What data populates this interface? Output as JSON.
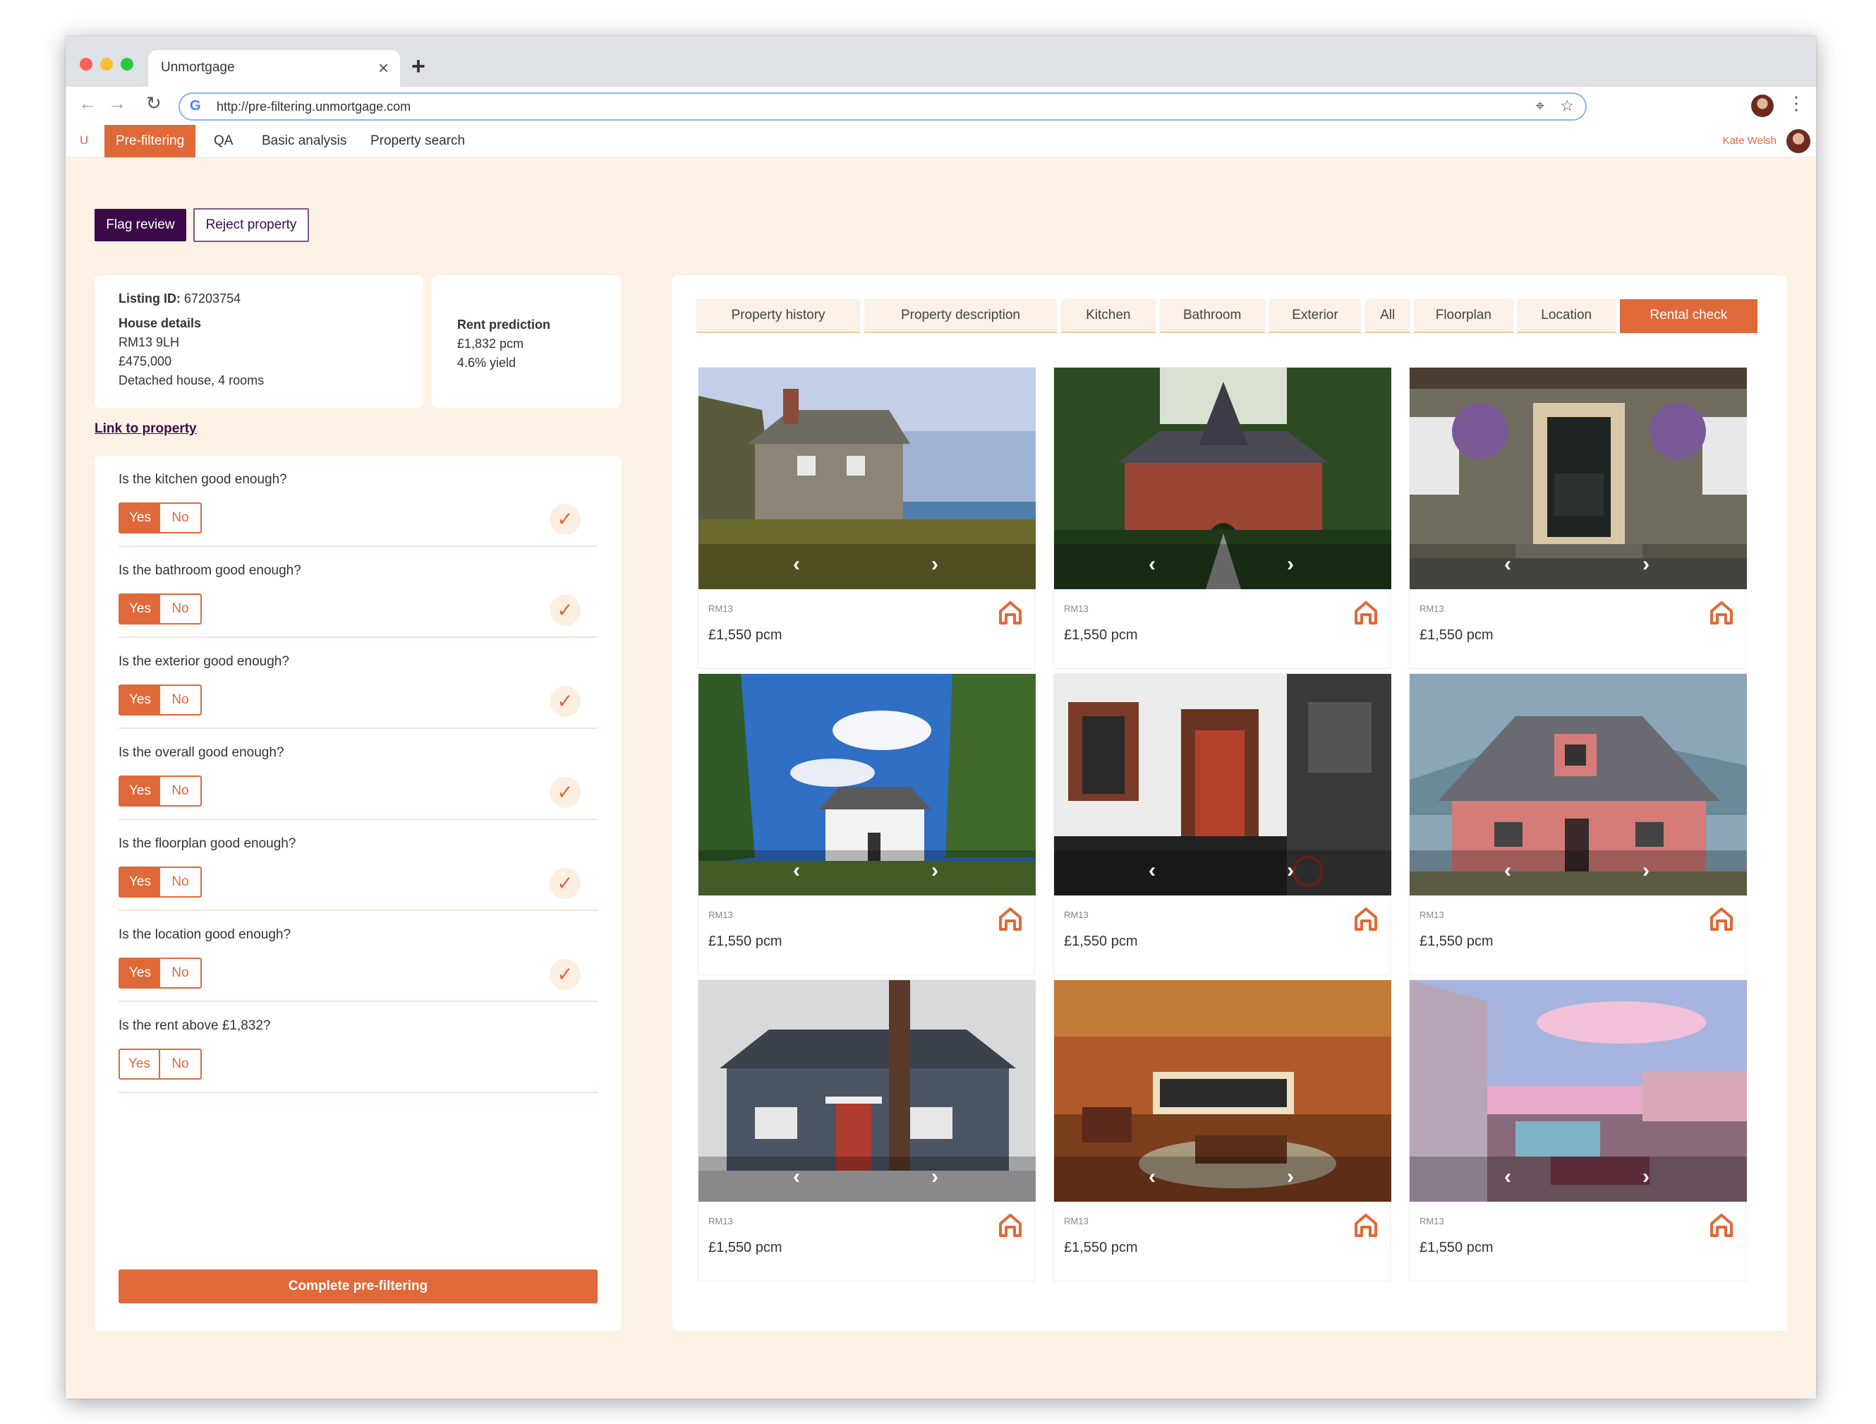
{
  "browser": {
    "tab_title": "Unmortgage",
    "tab_close": "×",
    "new_tab": "+",
    "url": "http://pre-filtering.unmortgage.com"
  },
  "appnav": {
    "logo": "U",
    "items": [
      "Pre-filtering",
      "QA",
      "Basic analysis",
      "Property search"
    ],
    "active_index": 0,
    "user_name": "Kate Welsh"
  },
  "actions": {
    "flag_review": "Flag review",
    "reject_property": "Reject property"
  },
  "listing": {
    "id_label": "Listing ID:",
    "id_value": "67203754",
    "house_details_label": "House details",
    "postcode": "RM13 9LH",
    "price": "£475,000",
    "description": "Detached house, 4 rooms"
  },
  "rent": {
    "label": "Rent prediction",
    "pcm": "£1,832 pcm",
    "yield": "4.6% yield"
  },
  "link_to_property": "Link to property",
  "questions": [
    {
      "text": "Is the kitchen good enough?",
      "yes": "Yes",
      "no": "No",
      "answered": true
    },
    {
      "text": "Is the bathroom good enough?",
      "yes": "Yes",
      "no": "No",
      "answered": true
    },
    {
      "text": "Is the exterior good enough?",
      "yes": "Yes",
      "no": "No",
      "answered": true
    },
    {
      "text": "Is the overall good enough?",
      "yes": "Yes",
      "no": "No",
      "answered": true
    },
    {
      "text": "Is the floorplan good enough?",
      "yes": "Yes",
      "no": "No",
      "answered": true
    },
    {
      "text": "Is the location good enough?",
      "yes": "Yes",
      "no": "No",
      "answered": true
    },
    {
      "text": "Is the rent above £1,832?",
      "yes": "Yes",
      "no": "No",
      "answered": false
    }
  ],
  "complete_button": "Complete pre-filtering",
  "tabs": [
    {
      "label": "Property history"
    },
    {
      "label": "Property description"
    },
    {
      "label": "Kitchen"
    },
    {
      "label": "Bathroom"
    },
    {
      "label": "Exterior"
    },
    {
      "label": "All"
    },
    {
      "label": "Floorplan"
    },
    {
      "label": "Location"
    },
    {
      "label": "Rental check"
    }
  ],
  "active_tab": "Rental check",
  "listings": [
    {
      "code": "RM13",
      "price": "£1,550 pcm",
      "scene": "stone-cottage"
    },
    {
      "code": "RM13",
      "price": "£1,550 pcm",
      "scene": "brick-lodge"
    },
    {
      "code": "RM13",
      "price": "£1,550 pcm",
      "scene": "front-door"
    },
    {
      "code": "RM13",
      "price": "£1,550 pcm",
      "scene": "white-house"
    },
    {
      "code": "RM13",
      "price": "£1,550 pcm",
      "scene": "townhouse"
    },
    {
      "code": "RM13",
      "price": "£1,550 pcm",
      "scene": "pink-house"
    },
    {
      "code": "RM13",
      "price": "£1,550 pcm",
      "scene": "grey-house"
    },
    {
      "code": "RM13",
      "price": "£1,550 pcm",
      "scene": "games-room"
    },
    {
      "code": "RM13",
      "price": "£1,550 pcm",
      "scene": "rooftop-terrace"
    }
  ],
  "colors": {
    "accent": "#e0693a",
    "brand_dark": "#3c0a49",
    "page_bg": "#fcf1e4"
  },
  "icons": {
    "carousel_prev": "‹",
    "carousel_next": "›",
    "check": "✓",
    "favourite": "home-outline-icon"
  }
}
